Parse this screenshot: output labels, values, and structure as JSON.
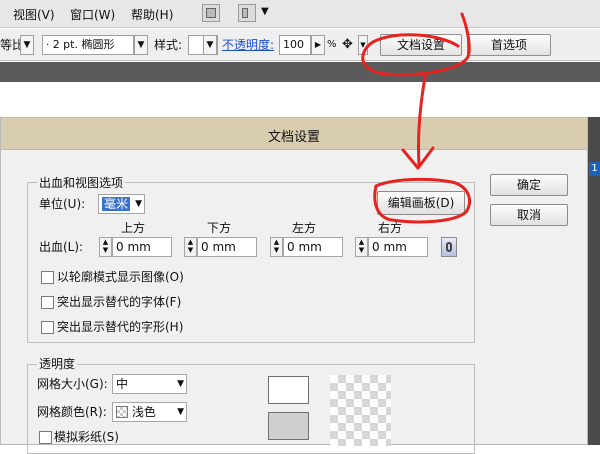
{
  "menubar": {
    "items": [
      "视图(V)",
      "窗口(W)",
      "帮助(H)"
    ]
  },
  "controlbar": {
    "partial_label": "等比",
    "stroke_value": "2 pt. 椭圆形",
    "style_label": "样式:",
    "opacity_label": "不透明度:",
    "opacity_value": "100",
    "percent_sign": "%",
    "doc_setup_button": "文档设置",
    "preferences_button": "首选项"
  },
  "dialog": {
    "title": "文档设置",
    "bleed_group": {
      "title": "出血和视图选项",
      "unit_label": "单位(U):",
      "unit_value": "毫米",
      "edit_artboards_button": "编辑画板(D)",
      "bleed_label": "出血(L):",
      "columns": [
        "上方",
        "下方",
        "左方",
        "右方"
      ],
      "values": [
        "0 mm",
        "0 mm",
        "0 mm",
        "0 mm"
      ],
      "options": [
        "以轮廓模式显示图像(O)",
        "突出显示替代的字体(F)",
        "突出显示替代的字形(H)"
      ]
    },
    "ok_button": "确定",
    "cancel_button": "取消",
    "transparency_group": {
      "title": "透明度",
      "grid_size_label": "网格大小(G):",
      "grid_size_value": "中",
      "grid_color_label": "网格颜色(R):",
      "grid_color_value": "浅色",
      "simulate_paper_label": "模拟彩纸(S)"
    }
  },
  "side_badge": "1",
  "colors": {
    "titlebar": "#d9cdb0",
    "annotation": "#e8231f",
    "highlight": "#3a73c9"
  }
}
